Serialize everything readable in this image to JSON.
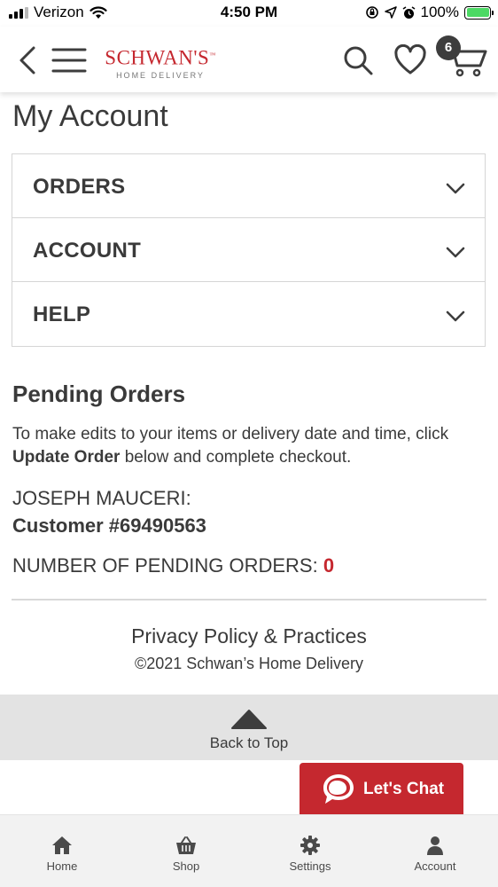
{
  "status_bar": {
    "carrier": "Verizon",
    "time": "4:50 PM",
    "battery": "100%"
  },
  "header": {
    "logo_text": "SCHWAN'S",
    "logo_tm": "™",
    "logo_subtitle": "HOME DELIVERY",
    "cart_count": "6"
  },
  "page": {
    "title": "My Account"
  },
  "accordion": [
    {
      "label": "ORDERS"
    },
    {
      "label": "ACCOUNT"
    },
    {
      "label": "HELP"
    }
  ],
  "pending": {
    "title": "Pending Orders",
    "instructions_pre": "To make edits to your items or delivery date and time, click ",
    "instructions_link": "Update Order",
    "instructions_post": " below and complete checkout.",
    "customer_name": "JOSEPH MAUCERI:",
    "customer_number": "Customer #69490563",
    "count_label": "NUMBER OF PENDING ORDERS: ",
    "count_value": "0"
  },
  "footer": {
    "privacy": "Privacy Policy & Practices",
    "copyright": "©2021 Schwan’s Home Delivery",
    "back_to_top": "Back to Top"
  },
  "chat": {
    "label": "Let's Chat"
  },
  "tabbar": [
    {
      "label": "Home",
      "icon": "home-icon"
    },
    {
      "label": "Shop",
      "icon": "basket-icon"
    },
    {
      "label": "Settings",
      "icon": "gear-icon"
    },
    {
      "label": "Account",
      "icon": "person-icon"
    }
  ],
  "colors": {
    "brand_red": "#c5282f",
    "text": "#3a3a3a",
    "battery_green": "#4cd964"
  }
}
